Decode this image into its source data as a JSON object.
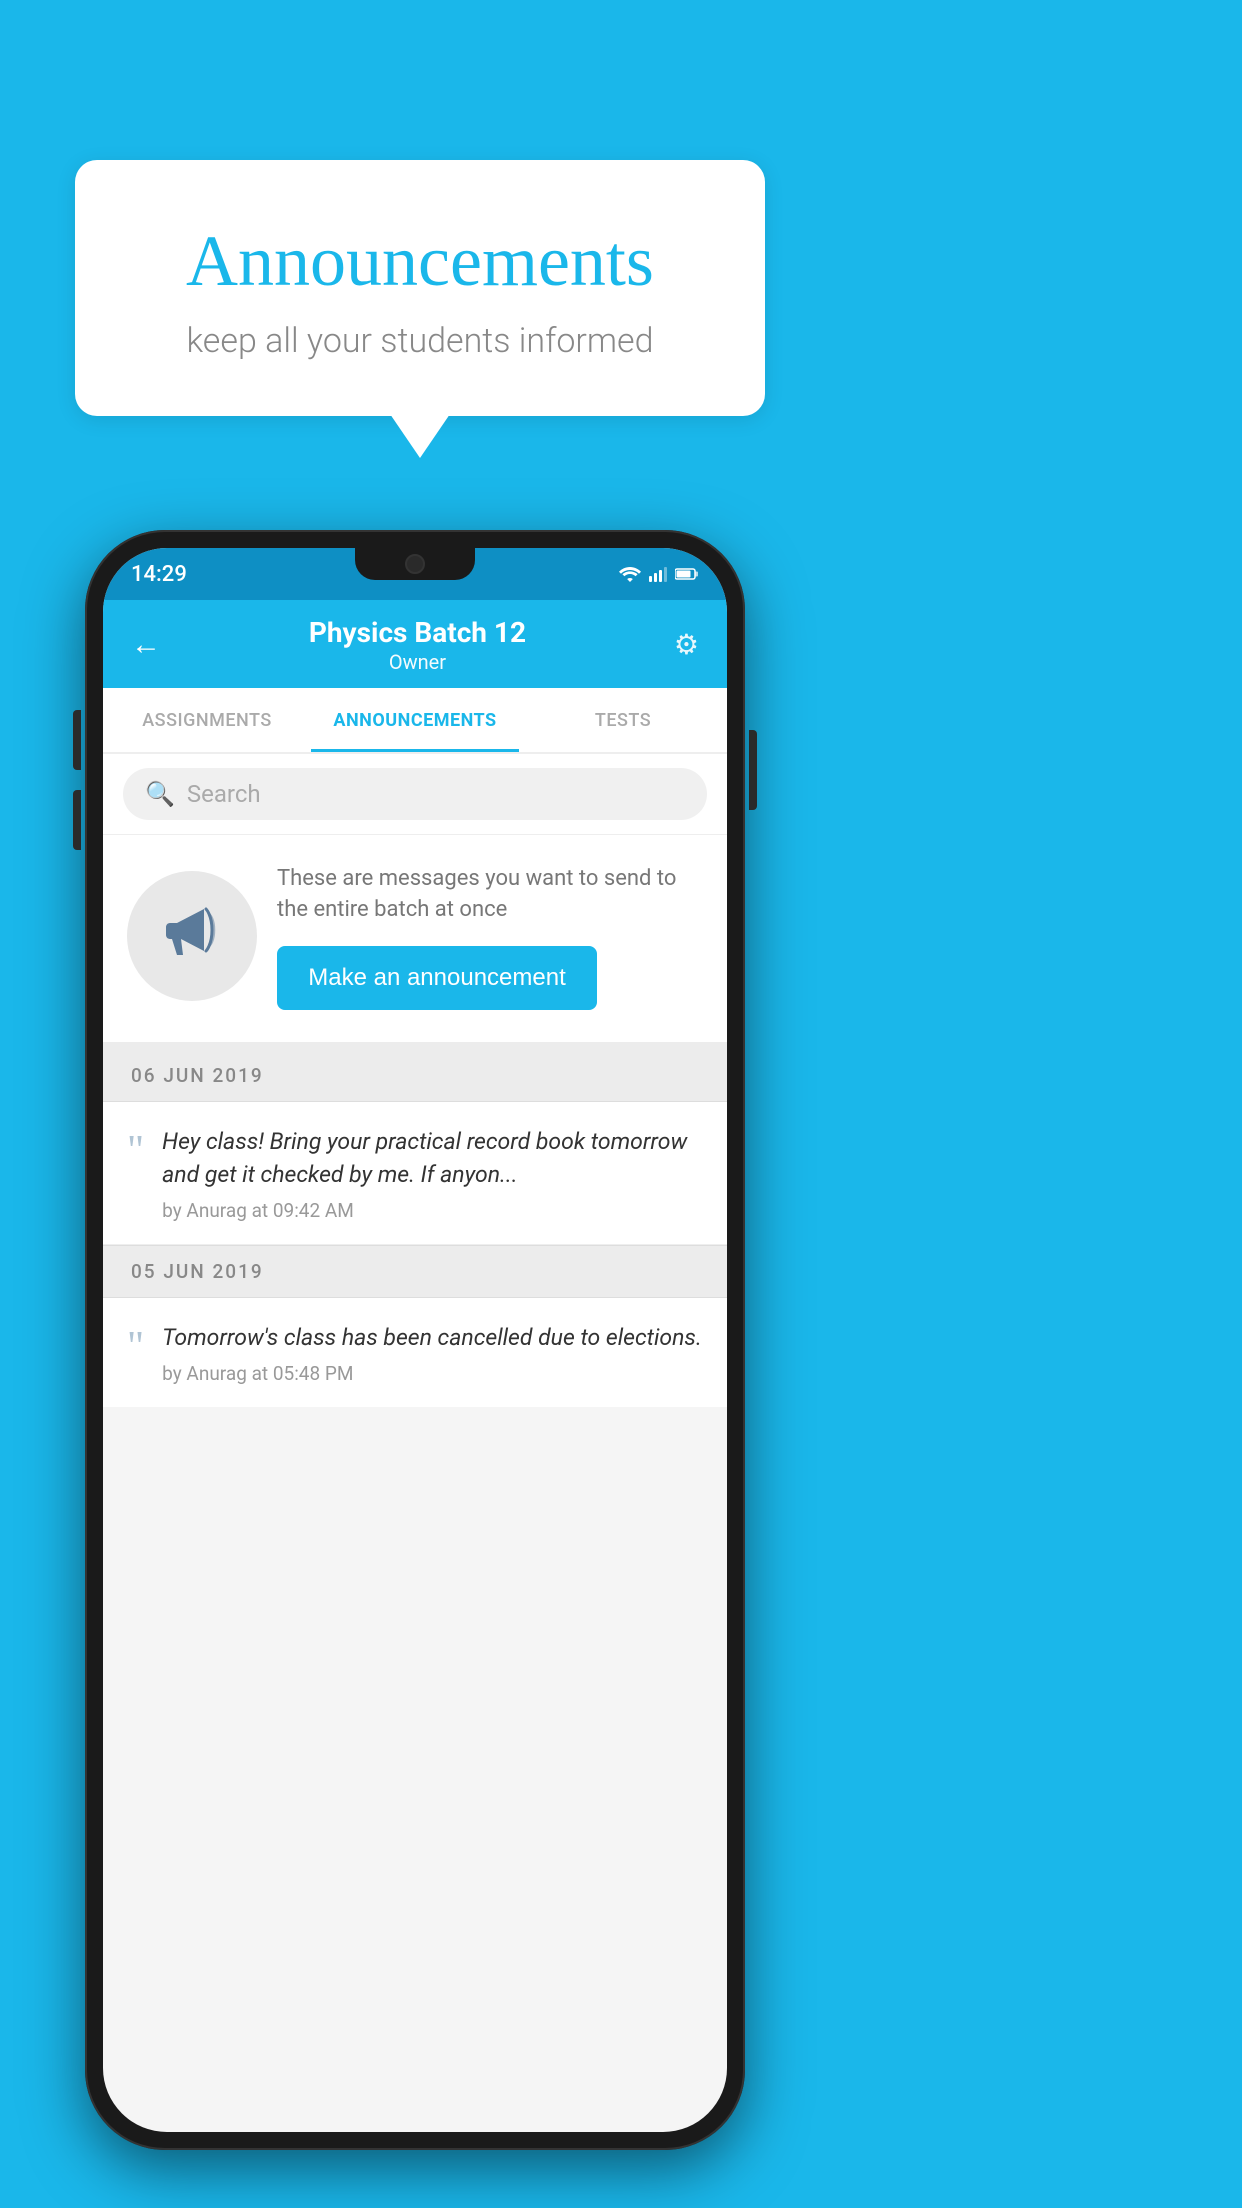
{
  "background_color": "#1ab7ea",
  "speech_bubble": {
    "title": "Announcements",
    "subtitle": "keep all your students informed"
  },
  "phone": {
    "status_bar": {
      "time": "14:29"
    },
    "header": {
      "title": "Physics Batch 12",
      "subtitle": "Owner",
      "back_label": "←",
      "gear_label": "⚙"
    },
    "tabs": [
      {
        "label": "ASSIGNMENTS",
        "active": false
      },
      {
        "label": "ANNOUNCEMENTS",
        "active": true
      },
      {
        "label": "TESTS",
        "active": false
      }
    ],
    "search": {
      "placeholder": "Search"
    },
    "announcement_prompt": {
      "description": "These are messages you want to send to the entire batch at once",
      "button_label": "Make an announcement"
    },
    "announcements": [
      {
        "date": "06  JUN  2019",
        "message": "Hey class! Bring your practical record book tomorrow and get it checked by me. If anyon...",
        "meta": "by Anurag at 09:42 AM"
      },
      {
        "date": "05  JUN  2019",
        "message": "Tomorrow's class has been cancelled due to elections.",
        "meta": "by Anurag at 05:48 PM"
      }
    ],
    "icons": {
      "search": "🔍",
      "megaphone": "📢",
      "quote": "“",
      "back": "←",
      "gear": "⚙"
    }
  }
}
